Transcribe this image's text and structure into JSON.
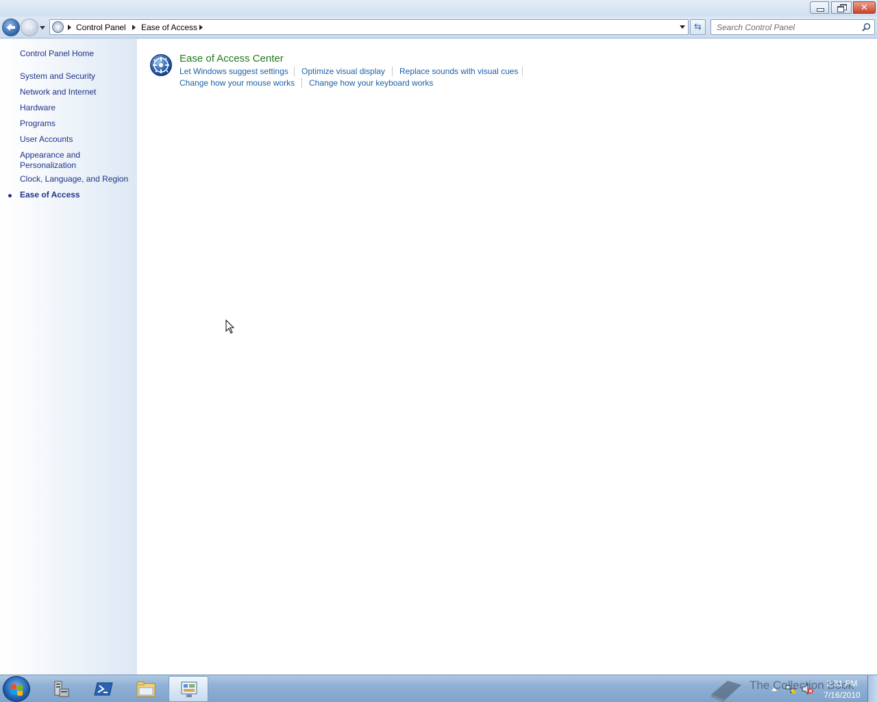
{
  "window": {
    "caption_buttons": {
      "minimize": "minimize",
      "maximize": "restore",
      "close": "✕"
    }
  },
  "address": {
    "breadcrumbs": [
      "Control Panel",
      "Ease of Access"
    ],
    "search_placeholder": "Search Control Panel"
  },
  "sidebar": {
    "home": "Control Panel Home",
    "items": [
      {
        "label": "System and Security"
      },
      {
        "label": "Network and Internet"
      },
      {
        "label": "Hardware"
      },
      {
        "label": "Programs"
      },
      {
        "label": "User Accounts"
      },
      {
        "label": "Appearance and Personalization",
        "line1": "Appearance and",
        "line2": "Personalization"
      },
      {
        "label": "Clock, Language, and Region"
      },
      {
        "label": "Ease of Access",
        "current": true
      }
    ]
  },
  "main": {
    "section": {
      "title": "Ease of Access Center",
      "icon": "ease-of-access-icon",
      "tasks_row1": [
        "Let Windows suggest settings",
        "Optimize visual display",
        "Replace sounds with visual cues"
      ],
      "tasks_row2": [
        "Change how your mouse works",
        "Change how your keyboard works"
      ]
    }
  },
  "taskbar": {
    "items": [
      {
        "name": "server-manager",
        "icon": "server-manager-icon"
      },
      {
        "name": "powershell",
        "icon": "powershell-icon"
      },
      {
        "name": "windows-explorer",
        "icon": "folder-icon"
      },
      {
        "name": "control-panel",
        "icon": "control-panel-icon",
        "active": true
      }
    ],
    "clock": {
      "time": "2:31 PM",
      "date": "7/16/2010"
    },
    "watermark": "The Collection Book"
  },
  "colors": {
    "link": "#1e3287",
    "task_link": "#1a5fa8",
    "section_title": "#1e7a1e",
    "sidebar_bg": "#dde8f4"
  }
}
